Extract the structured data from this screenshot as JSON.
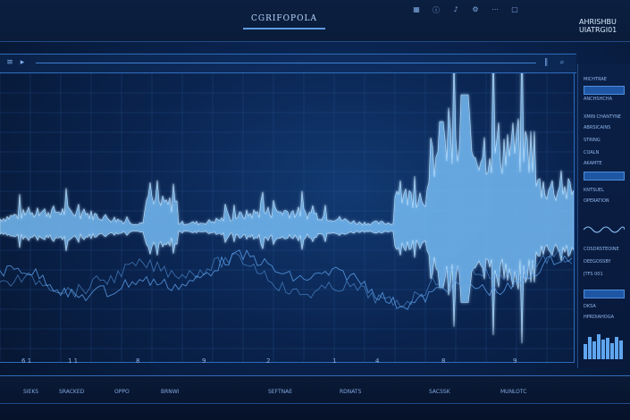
{
  "app": {
    "title": "CGRIFOPOLA",
    "brand_line1": "AHRISHBU",
    "brand_line2": "UIATRGI01"
  },
  "topbar": {
    "icons": [
      "grid-icon",
      "info-icon",
      "bell-icon",
      "settings-icon",
      "dots-icon",
      "window-icon"
    ]
  },
  "toolbar": {
    "buttons": [
      "menu-icon",
      "play-icon",
      "pause-icon",
      "zoom-icon"
    ]
  },
  "colors": {
    "background": "#07152e",
    "accent": "#4c8ee0",
    "waveform": "#7cc4ff",
    "waveform_glow": "#bfe4ff",
    "secondary_wave": "#5a9ee8"
  },
  "plot": {
    "x_ticks": [
      "6 1",
      "1 1",
      "8",
      "9",
      "2",
      "1",
      "4",
      "8",
      "9"
    ]
  },
  "panel": {
    "rows": [
      {
        "label": "MICHTRAE"
      },
      {
        "label": "ANCHSHCHA"
      },
      {
        "label": "XMIN CHANTYNE"
      },
      {
        "label": "ABRSICAINS"
      },
      {
        "label": "STRING"
      },
      {
        "label": "COALN"
      },
      {
        "label": "AKAMTE"
      },
      {
        "label": "KNTSUEL"
      },
      {
        "label": "OPERATION"
      },
      {
        "label": "COSDRSTEOINE"
      },
      {
        "label": "DEEGOSSBY"
      },
      {
        "label": "JTFS 001"
      },
      {
        "label": "DKSA"
      },
      {
        "label": "HPRDIAHOGA"
      }
    ],
    "bars": [
      0.6,
      0.9,
      0.7,
      1.0,
      0.8,
      0.85,
      0.65,
      0.9,
      0.75
    ]
  },
  "footer": {
    "items": [
      "SIEKS",
      "SRACKED",
      "OPPO",
      "BRNWI",
      "SEFTNAE",
      "RDNATS",
      "SACSSK",
      "MUNLOTC"
    ]
  }
}
